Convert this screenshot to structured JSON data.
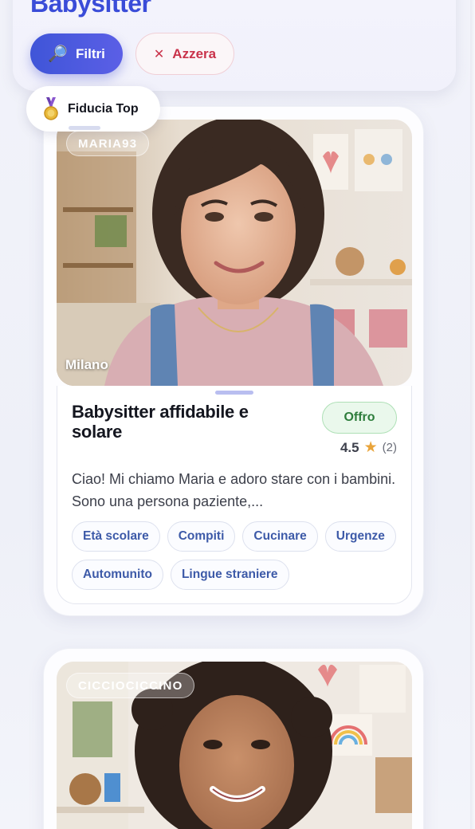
{
  "header": {
    "title": "Babysitter",
    "filter_button": {
      "label": "Filtri",
      "icon": "magnifier-icon"
    },
    "reset_button": {
      "label": "Azzera",
      "icon": "close-icon"
    }
  },
  "trust_badge": {
    "label": "Fiducia Top",
    "icon": "medal-icon"
  },
  "listings": [
    {
      "username": "MARIA93",
      "city": "Milano",
      "title": "Babysitter affidabile e solare",
      "type_badge": "Offro",
      "rating": "4.5",
      "reviews": "(2)",
      "description": "Ciao! Mi chiamo Maria e adoro stare con i bambini. Sono una persona paziente,...",
      "tags": [
        "Età scolare",
        "Compiti",
        "Cucinare",
        "Urgenze",
        "Automunito",
        "Lingue straniere"
      ]
    },
    {
      "username": "CICCIOCICCINO"
    }
  ],
  "colors": {
    "brand": "#3a4cd8",
    "reset": "#c9334b",
    "offer": "#2e7d3c",
    "star": "#e9a43a",
    "tag_text": "#3d5aa8"
  }
}
